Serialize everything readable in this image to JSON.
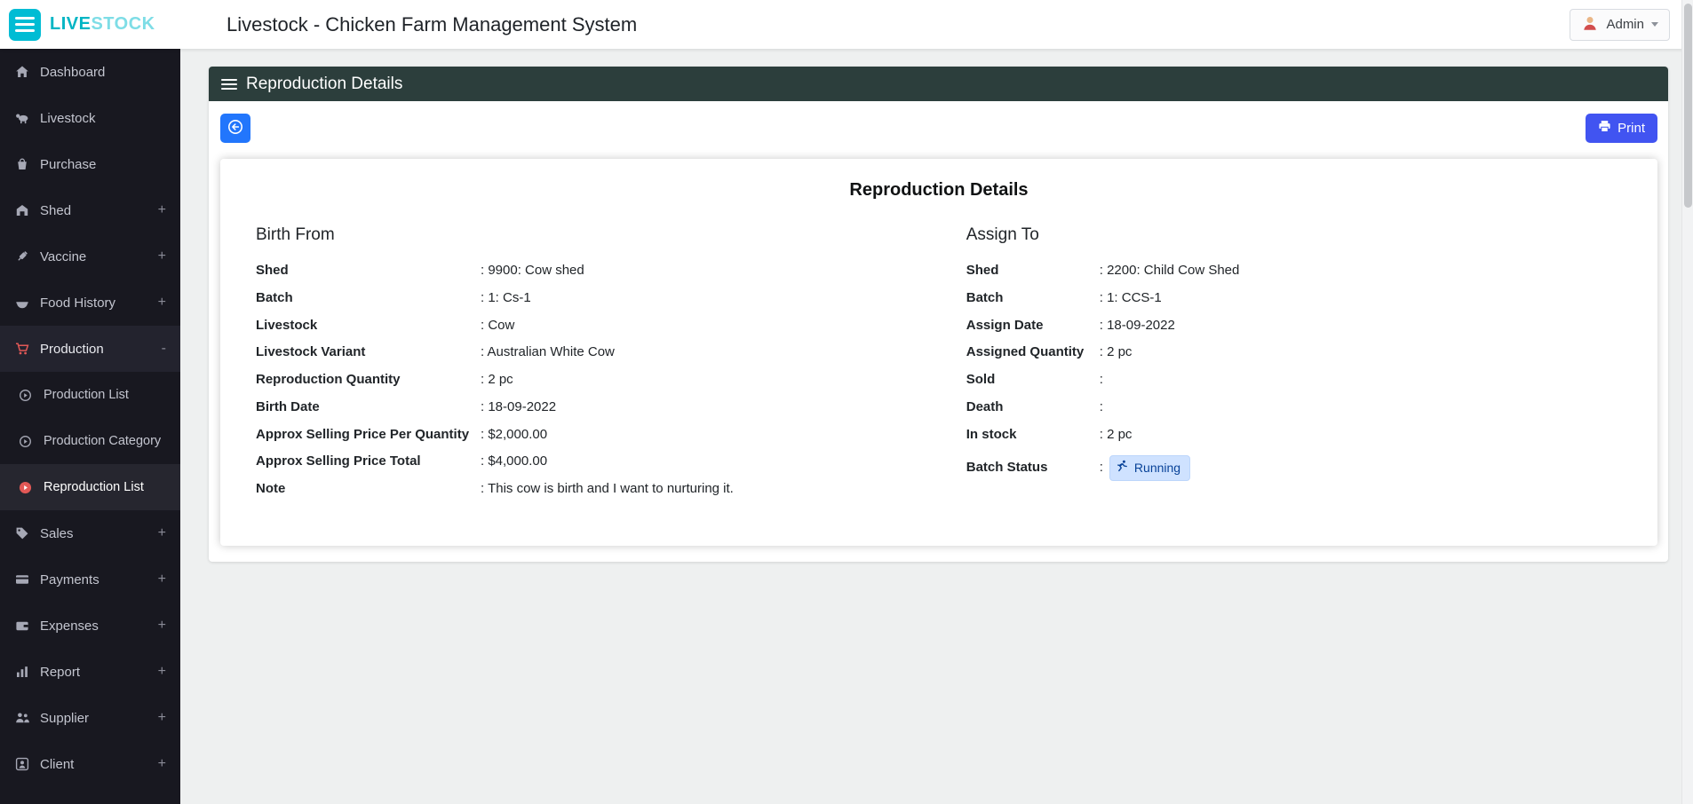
{
  "header": {
    "logo_live": "LIVE",
    "logo_stock": "STOCK",
    "title": "Livestock - Chicken Farm Management System",
    "user_label": "Admin"
  },
  "sidebar": {
    "items": [
      {
        "label": "Dashboard",
        "toggle": ""
      },
      {
        "label": "Livestock",
        "toggle": ""
      },
      {
        "label": "Purchase",
        "toggle": ""
      },
      {
        "label": "Shed",
        "toggle": "+"
      },
      {
        "label": "Vaccine",
        "toggle": "+"
      },
      {
        "label": "Food History",
        "toggle": "+"
      },
      {
        "label": "Production",
        "toggle": "-"
      },
      {
        "label": "Production List",
        "toggle": ""
      },
      {
        "label": "Production Category",
        "toggle": ""
      },
      {
        "label": "Reproduction List",
        "toggle": ""
      },
      {
        "label": "Sales",
        "toggle": "+"
      },
      {
        "label": "Payments",
        "toggle": "+"
      },
      {
        "label": "Expenses",
        "toggle": "+"
      },
      {
        "label": "Report",
        "toggle": "+"
      },
      {
        "label": "Supplier",
        "toggle": "+"
      },
      {
        "label": "Client",
        "toggle": "+"
      }
    ]
  },
  "page": {
    "panel_title": "Reproduction Details",
    "print_label": "Print",
    "card_title": "Reproduction Details",
    "birth_from": {
      "heading": "Birth From",
      "rows": [
        {
          "label": "Shed",
          "value": ": 9900: Cow shed"
        },
        {
          "label": "Batch",
          "value": ": 1: Cs-1"
        },
        {
          "label": "Livestock",
          "value": ": Cow"
        },
        {
          "label": "Livestock Variant",
          "value": ": Australian White Cow"
        },
        {
          "label": "Reproduction Quantity",
          "value": ": 2 pc"
        },
        {
          "label": "Birth Date",
          "value": ": 18-09-2022"
        },
        {
          "label": "Approx Selling Price Per Quantity",
          "value": ": $2,000.00"
        },
        {
          "label": "Approx Selling Price Total",
          "value": ": $4,000.00"
        },
        {
          "label": "Note",
          "value": ": This cow is birth and I want to nurturing it."
        }
      ]
    },
    "assign_to": {
      "heading": "Assign To",
      "rows": [
        {
          "label": "Shed",
          "value": ": 2200: Child Cow Shed"
        },
        {
          "label": "Batch",
          "value": ": 1: CCS-1"
        },
        {
          "label": "Assign Date",
          "value": ": 18-09-2022"
        },
        {
          "label": "Assigned Quantity",
          "value": ": 2 pc"
        },
        {
          "label": "Sold",
          "value": ":"
        },
        {
          "label": "Death",
          "value": ":"
        },
        {
          "label": "In stock",
          "value": ": 2 pc"
        }
      ],
      "status": {
        "label": "Batch Status",
        "value": ":",
        "badge": "Running"
      }
    }
  },
  "colors": {
    "brand_teal": "#00bcd4",
    "panel_header": "#2c3e3c",
    "back_button_blue": "#2276fc",
    "print_button_blue": "#4154f1",
    "badge_bg": "#cfe2ff",
    "badge_text": "#084298",
    "sidebar_bg": "#181820",
    "active_red": "#e25856"
  }
}
